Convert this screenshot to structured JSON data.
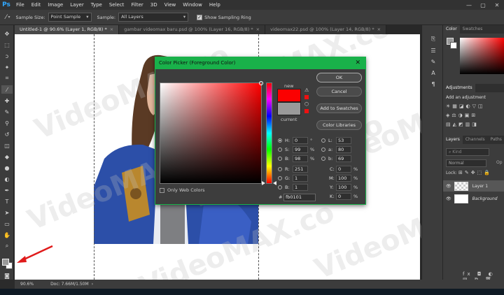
{
  "app": {
    "logo": "Ps"
  },
  "menu": [
    "File",
    "Edit",
    "Image",
    "Layer",
    "Type",
    "Select",
    "Filter",
    "3D",
    "View",
    "Window",
    "Help"
  ],
  "options": {
    "sample_size_label": "Sample Size:",
    "sample_size_value": "Point Sample",
    "sample_label": "Sample:",
    "sample_value": "All Layers",
    "sampling_ring_label": "Show Sampling Ring"
  },
  "tabs": [
    {
      "label": "Untitled-1 @ 90.6% (Layer 1, RGB/8) *"
    },
    {
      "label": "gambar videomax baru.psd @ 100% (Layer 16, RGB/8) *"
    },
    {
      "label": "videomax22.psd @ 100% (Layer 14, RGB/8) *"
    }
  ],
  "watermark": "VideoMAX.co",
  "dialog": {
    "title": "Color Picker (Foreground Color)",
    "new_label": "new",
    "current_label": "current",
    "new_color": "#fb0101",
    "current_color": "#9a9a9a",
    "buttons": {
      "ok": "OK",
      "cancel": "Cancel",
      "add_swatches": "Add to Swatches",
      "libraries": "Color Libraries"
    },
    "only_web_colors": "Only Web Colors",
    "hsb": {
      "h": "0",
      "s": "99",
      "b": "98"
    },
    "rgb": {
      "r": "251",
      "g": "1",
      "b": "1"
    },
    "lab": {
      "l": "53",
      "a": "80",
      "b": "69"
    },
    "cmyk": {
      "c": "0",
      "m": "100",
      "y": "100",
      "k": "0"
    },
    "hex": "fb0101",
    "labels": {
      "h": "H:",
      "s": "S:",
      "b": "B:",
      "r": "R:",
      "g": "G:",
      "bb": "B:",
      "l": "L:",
      "a": "a:",
      "lb": "b:",
      "c": "C:",
      "m": "M:",
      "y": "Y:",
      "k": "K:",
      "hash": "#"
    },
    "units": {
      "deg": "°",
      "pct": "%"
    }
  },
  "right_panel": {
    "color_tab": "Color",
    "swatches_tab": "Swatches",
    "adjustments_tab": "Adjustments",
    "add_adjustment": "Add an adjustment",
    "layers_tab": "Layers",
    "channels_tab": "Channels",
    "paths_tab": "Paths",
    "kind_placeholder": "Kind",
    "blend_mode": "Normal",
    "opacity_short": "Op",
    "lock_label": "Lock:",
    "layers": [
      {
        "name": "Layer 1"
      },
      {
        "name": "Background"
      }
    ]
  },
  "status": {
    "zoom": "90.6%",
    "doc": "Doc: 7.66M/1.50M"
  }
}
